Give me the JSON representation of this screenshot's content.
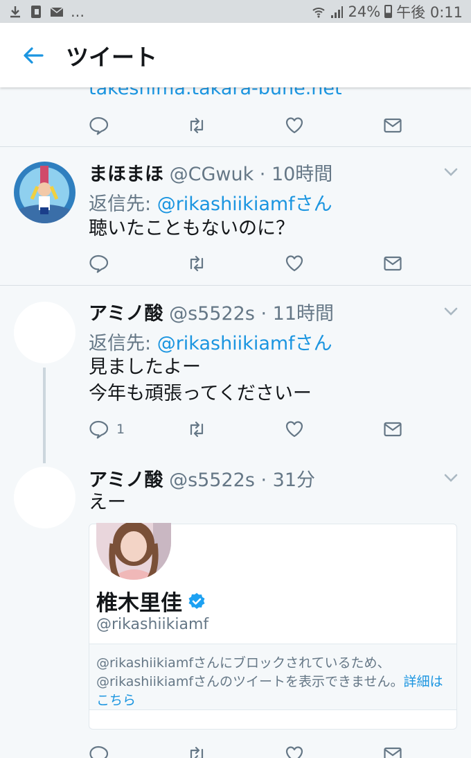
{
  "status_bar": {
    "left_more": "...",
    "battery": "24%",
    "time": "午後 0:11"
  },
  "header": {
    "title": "ツイート"
  },
  "partial_tweet": {
    "link_text": "takeshima.takara-bune.net"
  },
  "tweets": [
    {
      "name": "まほまほ",
      "meta": "@CGwuk · 10時間",
      "reply_prefix": "返信先: ",
      "reply_handle": "@rikashiikiamfさん",
      "lines": [
        "聴いたこともないのに？"
      ],
      "reply_count": ""
    },
    {
      "name": "アミノ酸",
      "meta": "@s5522s · 11時間",
      "reply_prefix": "返信先: ",
      "reply_handle": "@rikashiikiamfさん",
      "lines": [
        "見ましたよー",
        "今年も頑張ってくださいー"
      ],
      "reply_count": "1"
    },
    {
      "name": "アミノ酸",
      "meta": "@s5522s · 31分",
      "lines": [
        "えー"
      ]
    }
  ],
  "quoted_card": {
    "name": "椎木里佳",
    "handle": "@rikashiikiamf",
    "notice_line1": "@rikashiikiamfさんにブロックされているため、",
    "notice_line2": "@rikashiikiamfさんのツイートを表示できません。",
    "notice_more_1": "詳細は",
    "notice_more_2": "こちら"
  },
  "icons": [
    "download-icon",
    "sim-icon",
    "mail-notification-icon",
    "wifi-icon",
    "signal-icon",
    "battery-icon",
    "back-arrow-icon",
    "reply-icon",
    "retweet-icon",
    "like-icon",
    "dm-icon",
    "caret-down-icon",
    "verified-badge-icon"
  ],
  "colors": {
    "accent": "#1b95e0",
    "background": "#f5f8fa",
    "secondary_text": "#657786"
  }
}
